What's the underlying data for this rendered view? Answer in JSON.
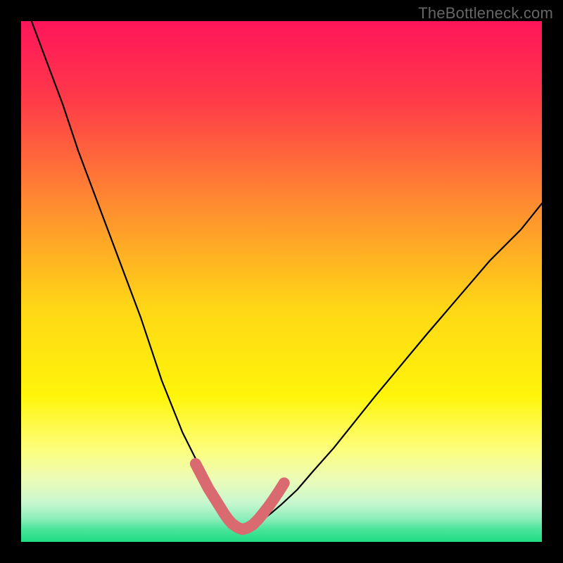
{
  "watermark": "TheBottleneck.com",
  "chart_data": {
    "type": "line",
    "title": "",
    "xlabel": "",
    "ylabel": "",
    "xlim": [
      0,
      100
    ],
    "ylim": [
      0,
      100
    ],
    "grid": false,
    "notes": "Colored heat-map background (red→yellow→green from top to bottom, green concentrated at very bottom). A thin black V-shaped bottleneck curve with a rounded red highlight strip covering the bottom ~10% of each descending arm near the trough.",
    "background_gradient_stops": [
      {
        "pos": 0.0,
        "color": "#ff155a"
      },
      {
        "pos": 0.15,
        "color": "#ff3a49"
      },
      {
        "pos": 0.35,
        "color": "#ff8b30"
      },
      {
        "pos": 0.55,
        "color": "#ffd716"
      },
      {
        "pos": 0.72,
        "color": "#fff50a"
      },
      {
        "pos": 0.82,
        "color": "#fdfe7a"
      },
      {
        "pos": 0.88,
        "color": "#ecfcb8"
      },
      {
        "pos": 0.925,
        "color": "#c8f7cf"
      },
      {
        "pos": 0.955,
        "color": "#8deebb"
      },
      {
        "pos": 0.975,
        "color": "#4ce59b"
      },
      {
        "pos": 1.0,
        "color": "#1edc82"
      }
    ],
    "series": [
      {
        "name": "bottleneck-curve-left",
        "stroke": "#000000",
        "x": [
          2,
          5,
          8,
          11,
          14,
          17,
          20,
          23,
          25,
          27,
          29,
          31,
          33,
          34.5,
          36,
          37.5,
          39,
          40,
          41,
          42.5
        ],
        "y": [
          100,
          92,
          84,
          75,
          67,
          59,
          51,
          43,
          37,
          31,
          26,
          21,
          17,
          14,
          11,
          8.5,
          6,
          4.5,
          3.2,
          2.4
        ]
      },
      {
        "name": "bottleneck-curve-right",
        "stroke": "#000000",
        "x": [
          42.5,
          44,
          46,
          48,
          50,
          53,
          56,
          60,
          64,
          68,
          73,
          78,
          84,
          90,
          96,
          100
        ],
        "y": [
          2.4,
          2.8,
          4,
          5.5,
          7.2,
          10,
          13.5,
          18,
          23,
          28,
          34,
          40,
          47,
          54,
          60,
          65
        ]
      },
      {
        "name": "trough-highlight-left",
        "stroke": "#d96a70",
        "thick": true,
        "x": [
          33.5,
          34.8,
          36,
          37.2,
          38.2,
          39,
          39.8,
          40.5
        ],
        "y": [
          15,
          12.5,
          10.2,
          8.3,
          6.7,
          5.4,
          4.3,
          3.5
        ]
      },
      {
        "name": "trough-highlight-bottom",
        "stroke": "#d96a70",
        "thick": true,
        "x": [
          40.5,
          41.5,
          42.5,
          43.5,
          44.5
        ],
        "y": [
          3.5,
          2.8,
          2.4,
          2.7,
          3.3
        ]
      },
      {
        "name": "trough-highlight-right",
        "stroke": "#d96a70",
        "thick": true,
        "x": [
          44.5,
          45.5,
          46.5,
          47.5,
          48.5,
          49.5,
          50.5
        ],
        "y": [
          3.3,
          4.3,
          5.5,
          6.8,
          8.2,
          9.7,
          11.3
        ]
      }
    ]
  }
}
